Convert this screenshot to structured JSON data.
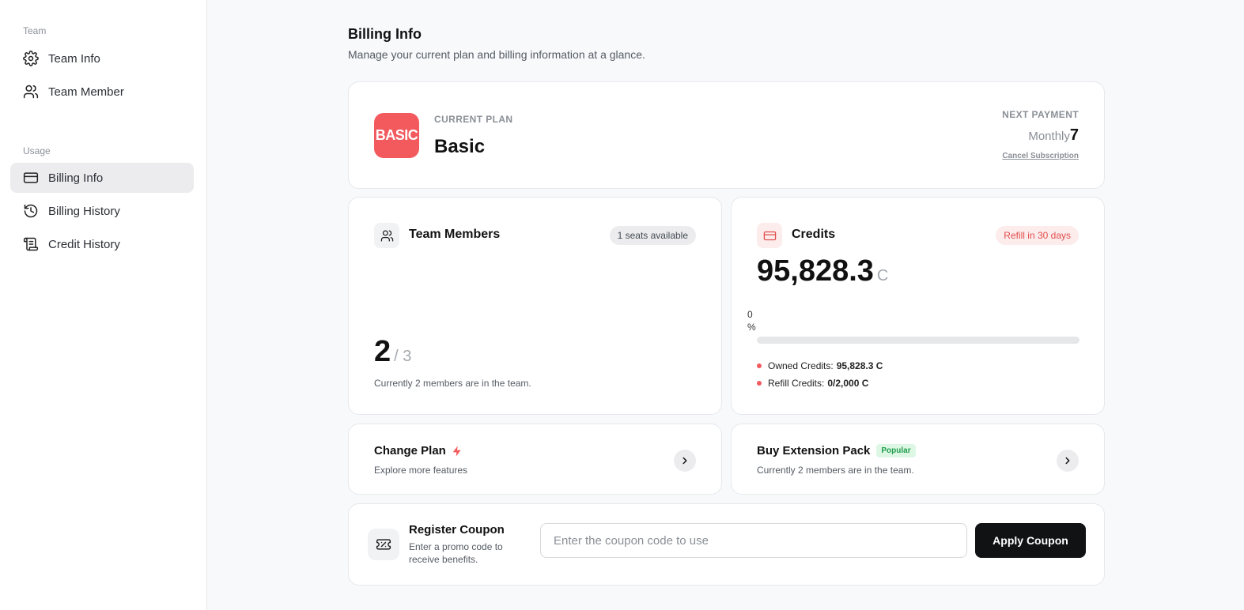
{
  "sidebar": {
    "sections": [
      {
        "label": "Team",
        "items": [
          {
            "label": "Team Info",
            "icon": "gear-icon"
          },
          {
            "label": "Team Member",
            "icon": "users-icon"
          }
        ]
      },
      {
        "label": "Usage",
        "items": [
          {
            "label": "Billing Info",
            "icon": "credit-card-icon",
            "active": true
          },
          {
            "label": "Billing History",
            "icon": "history-icon"
          },
          {
            "label": "Credit History",
            "icon": "scroll-icon"
          }
        ]
      }
    ]
  },
  "header": {
    "title": "Billing Info",
    "subtitle": "Manage your current plan and billing information at a glance."
  },
  "plan": {
    "logo_text": "BASIC",
    "label": "CURRENT PLAN",
    "name": "Basic",
    "next_payment_label": "NEXT PAYMENT",
    "next_payment_cycle": "Monthly",
    "next_payment_value": "7",
    "cancel_label": "Cancel Subscription",
    "logo_color": "#f25a5e"
  },
  "members": {
    "title": "Team Members",
    "seats_badge": "1 seats available",
    "count": "2",
    "total": "/ 3",
    "description": "Currently 2 members are in the team."
  },
  "credits": {
    "title": "Credits",
    "refill_badge": "Refill in 30 days",
    "amount": "95,828.3",
    "unit": "C",
    "progress_label": "0 %",
    "progress_percent": 0,
    "owned_label": "Owned Credits:",
    "owned_value": "95,828.3 C",
    "refill_label": "Refill Credits:",
    "refill_value": "0/2,000 C"
  },
  "actions": {
    "change_plan": {
      "title": "Change Plan",
      "subtitle": "Explore more features"
    },
    "extension": {
      "title": "Buy Extension Pack",
      "badge": "Popular",
      "subtitle": "Currently 2 members are in the team."
    }
  },
  "coupon": {
    "title": "Register Coupon",
    "subtitle": "Enter a promo code to receive benefits.",
    "placeholder": "Enter the coupon code to use",
    "value": "",
    "button_label": "Apply Coupon"
  }
}
